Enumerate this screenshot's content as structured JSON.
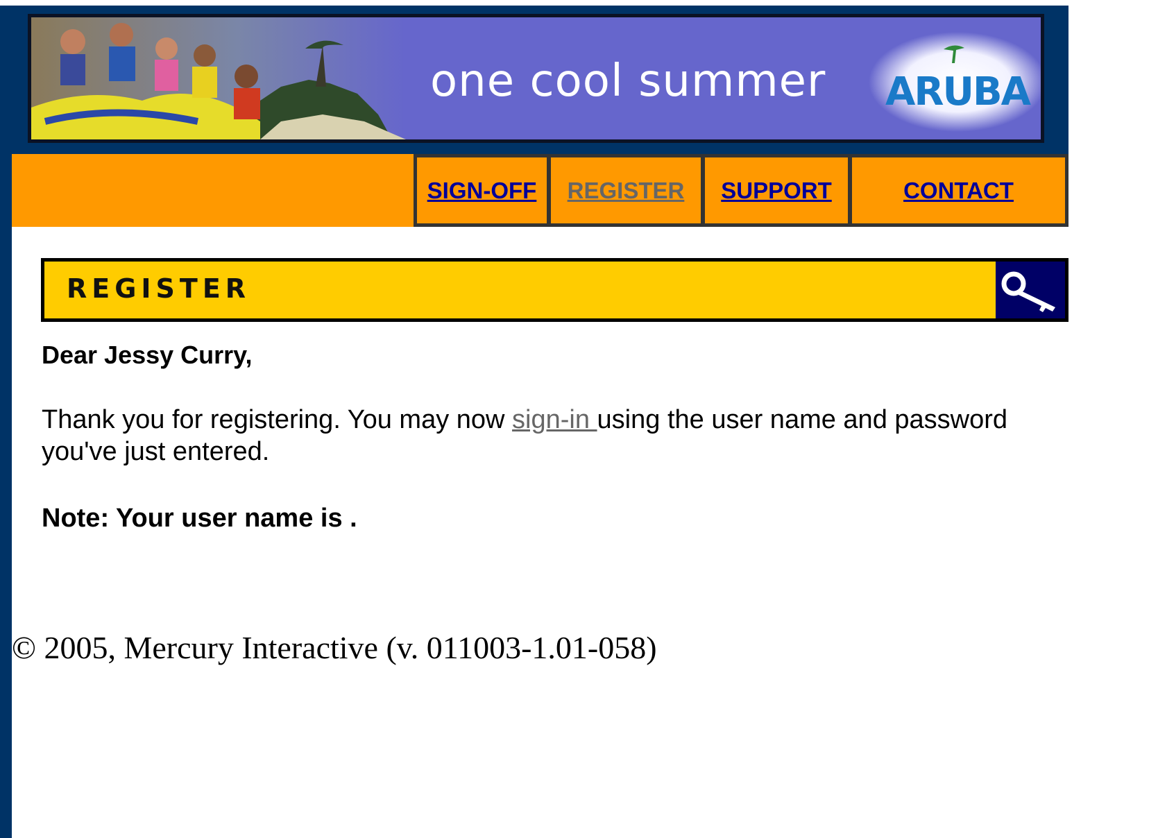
{
  "banner": {
    "title": "one cool summer",
    "logo_text": "ARUBA"
  },
  "nav": {
    "items": [
      {
        "label": "SIGN-OFF",
        "current": false
      },
      {
        "label": "REGISTER",
        "current": true
      },
      {
        "label": "SUPPORT",
        "current": false
      },
      {
        "label": "CONTACT",
        "current": false
      }
    ]
  },
  "page": {
    "title": "REGISTER",
    "title_icon": "key-icon"
  },
  "content": {
    "greeting": "Dear Jessy Curry,",
    "paragraph_before": "Thank you for registering. You may now ",
    "signin_link": "sign-in ",
    "paragraph_after": "using the user name and password you've just entered.",
    "note": "Note: Your user name is ."
  },
  "footer": {
    "copyright": "© 2005, Mercury Interactive (v. 011003-1.01-058)"
  },
  "colors": {
    "navy": "#003366",
    "banner_purple": "#6666cc",
    "nav_orange": "#ff9900",
    "title_yellow": "#ffcc00",
    "link_blue": "#000099",
    "visited_gray": "#666666"
  }
}
